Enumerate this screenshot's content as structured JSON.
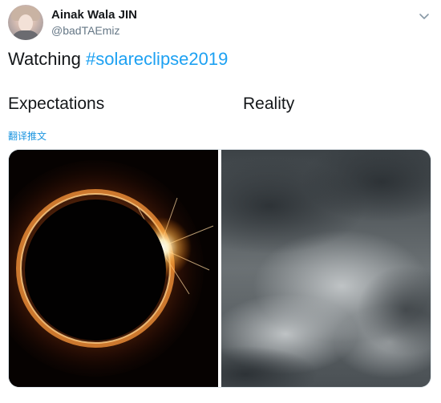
{
  "user": {
    "display_name": "Ainak Wala JIN",
    "handle": "@badTAEmiz",
    "avatar_icon": "profile-avatar"
  },
  "tweet": {
    "text_prefix": "Watching ",
    "hashtag": "#solareclipse2019",
    "label_left": "Expectations",
    "label_right": "Reality",
    "translate_link": "翻译推文"
  },
  "media": {
    "left_image": "solar-eclipse-diamond-ring",
    "right_image": "dark-storm-clouds"
  },
  "menu_icon": "chevron-down-icon",
  "colors": {
    "hashtag": "#1da1f2",
    "link": "#1b95e0",
    "handle_gray": "#657786",
    "text": "#14171a"
  }
}
